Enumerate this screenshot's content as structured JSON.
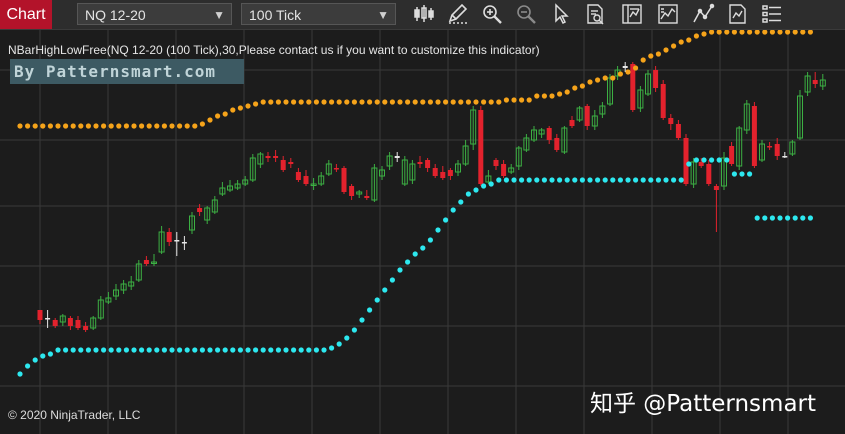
{
  "toolbar": {
    "chart_tab": "Chart",
    "instrument": "NQ 12-20",
    "period": "100 Tick",
    "icons": [
      "bar-type-icon",
      "draw-pencil-icon",
      "zoom-in-icon",
      "zoom-out-icon",
      "cursor-icon",
      "data-box-icon",
      "indicators-icon",
      "strategies-icon",
      "line-drawing-icon",
      "chart-style-icon",
      "properties-icon"
    ]
  },
  "chart": {
    "indicator_label": "NBarHighLowFree(NQ 12-20 (100 Tick),30,Please contact us if you want to customize this indicator)",
    "brand_label": "By Patternsmart.com",
    "copyright": "© 2020 NinjaTrader, LLC",
    "watermark": "知乎 @Patternsmart",
    "colors": {
      "background": "#1c1c1c",
      "grid": "#3a3a3a",
      "up_candle": "#3cb043",
      "down_candle": "#e3222d",
      "neutral_candle": "#e6e6e6",
      "high_dots": "#f5a31a",
      "low_dots": "#2de8ef"
    }
  },
  "chart_data": {
    "type": "candlestick",
    "candles": [
      [
        320,
        310,
        316,
        324,
        "d"
      ],
      [
        318,
        318,
        310,
        328,
        "n"
      ],
      [
        326,
        320,
        318,
        328,
        "d"
      ],
      [
        322,
        316,
        314,
        326,
        "u"
      ],
      [
        318,
        326,
        316,
        330,
        "d"
      ],
      [
        320,
        328,
        316,
        330,
        "d"
      ],
      [
        330,
        326,
        322,
        332,
        "d"
      ],
      [
        328,
        318,
        316,
        330,
        "u"
      ],
      [
        318,
        300,
        296,
        320,
        "u"
      ],
      [
        302,
        298,
        292,
        304,
        "u"
      ],
      [
        296,
        290,
        284,
        300,
        "u"
      ],
      [
        290,
        284,
        280,
        294,
        "u"
      ],
      [
        286,
        282,
        276,
        290,
        "u"
      ],
      [
        280,
        264,
        260,
        282,
        "u"
      ],
      [
        264,
        260,
        256,
        266,
        "d"
      ],
      [
        262,
        262,
        254,
        266,
        "u"
      ],
      [
        252,
        232,
        226,
        254,
        "u"
      ],
      [
        232,
        242,
        228,
        246,
        "d"
      ],
      [
        240,
        240,
        232,
        256,
        "n"
      ],
      [
        242,
        242,
        236,
        250,
        "n"
      ],
      [
        230,
        216,
        212,
        234,
        "u"
      ],
      [
        212,
        208,
        204,
        216,
        "d"
      ],
      [
        220,
        208,
        206,
        224,
        "u"
      ],
      [
        212,
        200,
        196,
        214,
        "u"
      ],
      [
        194,
        188,
        182,
        196,
        "u"
      ],
      [
        190,
        186,
        180,
        192,
        "u"
      ],
      [
        188,
        184,
        180,
        190,
        "u"
      ],
      [
        184,
        180,
        176,
        186,
        "u"
      ],
      [
        180,
        158,
        154,
        182,
        "u"
      ],
      [
        164,
        154,
        152,
        168,
        "u"
      ],
      [
        158,
        156,
        152,
        162,
        "d"
      ],
      [
        156,
        158,
        150,
        162,
        "d"
      ],
      [
        160,
        170,
        156,
        172,
        "d"
      ],
      [
        164,
        162,
        158,
        168,
        "d"
      ],
      [
        172,
        180,
        168,
        182,
        "d"
      ],
      [
        176,
        184,
        170,
        186,
        "d"
      ],
      [
        184,
        184,
        178,
        190,
        "u"
      ],
      [
        184,
        176,
        172,
        186,
        "u"
      ],
      [
        174,
        164,
        160,
        176,
        "u"
      ],
      [
        168,
        168,
        164,
        172,
        "d"
      ],
      [
        168,
        192,
        166,
        194,
        "d"
      ],
      [
        186,
        196,
        184,
        200,
        "d"
      ],
      [
        194,
        192,
        190,
        198,
        "u"
      ],
      [
        196,
        198,
        190,
        200,
        "d"
      ],
      [
        200,
        168,
        164,
        202,
        "u"
      ],
      [
        170,
        176,
        166,
        180,
        "u"
      ],
      [
        166,
        156,
        152,
        170,
        "u"
      ],
      [
        158,
        156,
        152,
        162,
        "n"
      ],
      [
        160,
        184,
        156,
        186,
        "u"
      ],
      [
        180,
        164,
        160,
        184,
        "u"
      ],
      [
        164,
        162,
        156,
        168,
        "d"
      ],
      [
        160,
        168,
        158,
        172,
        "d"
      ],
      [
        168,
        176,
        164,
        178,
        "d"
      ],
      [
        172,
        178,
        166,
        180,
        "d"
      ],
      [
        176,
        170,
        168,
        180,
        "d"
      ],
      [
        172,
        164,
        160,
        176,
        "u"
      ],
      [
        164,
        146,
        140,
        166,
        "u"
      ],
      [
        144,
        110,
        106,
        150,
        "u"
      ],
      [
        110,
        184,
        106,
        186,
        "d"
      ],
      [
        176,
        182,
        170,
        184,
        "u"
      ],
      [
        166,
        160,
        158,
        170,
        "d"
      ],
      [
        164,
        176,
        160,
        178,
        "d"
      ],
      [
        172,
        168,
        164,
        174,
        "u"
      ],
      [
        166,
        148,
        146,
        170,
        "u"
      ],
      [
        150,
        138,
        134,
        152,
        "u"
      ],
      [
        140,
        130,
        126,
        142,
        "u"
      ],
      [
        130,
        134,
        128,
        138,
        "u"
      ],
      [
        128,
        140,
        126,
        144,
        "d"
      ],
      [
        138,
        150,
        134,
        152,
        "d"
      ],
      [
        152,
        128,
        126,
        154,
        "u"
      ],
      [
        126,
        120,
        116,
        128,
        "d"
      ],
      [
        120,
        108,
        106,
        122,
        "u"
      ],
      [
        106,
        126,
        104,
        130,
        "d"
      ],
      [
        126,
        116,
        110,
        130,
        "u"
      ],
      [
        114,
        106,
        102,
        118,
        "u"
      ],
      [
        104,
        78,
        74,
        106,
        "u"
      ],
      [
        76,
        70,
        66,
        80,
        "u"
      ],
      [
        68,
        66,
        62,
        72,
        "n"
      ],
      [
        64,
        110,
        62,
        112,
        "d"
      ],
      [
        108,
        90,
        86,
        112,
        "u"
      ],
      [
        94,
        74,
        70,
        96,
        "u"
      ],
      [
        70,
        88,
        66,
        92,
        "d"
      ],
      [
        84,
        118,
        80,
        120,
        "d"
      ],
      [
        118,
        124,
        114,
        130,
        "d"
      ],
      [
        124,
        138,
        120,
        140,
        "d"
      ],
      [
        138,
        184,
        134,
        186,
        "d"
      ],
      [
        184,
        162,
        158,
        188,
        "u"
      ],
      [
        162,
        166,
        158,
        168,
        "d"
      ],
      [
        164,
        184,
        160,
        186,
        "d"
      ],
      [
        186,
        190,
        184,
        232,
        "d"
      ],
      [
        186,
        158,
        152,
        190,
        "u"
      ],
      [
        146,
        164,
        142,
        166,
        "d"
      ],
      [
        166,
        128,
        126,
        170,
        "u"
      ],
      [
        130,
        104,
        100,
        134,
        "u"
      ],
      [
        106,
        166,
        102,
        168,
        "d"
      ],
      [
        160,
        144,
        140,
        162,
        "u"
      ],
      [
        146,
        146,
        142,
        150,
        "d"
      ],
      [
        144,
        156,
        138,
        160,
        "d"
      ],
      [
        156,
        156,
        152,
        158,
        "n"
      ],
      [
        154,
        142,
        140,
        156,
        "u"
      ],
      [
        138,
        96,
        90,
        140,
        "u"
      ],
      [
        92,
        76,
        72,
        96,
        "u"
      ],
      [
        80,
        84,
        72,
        88,
        "d"
      ],
      [
        86,
        80,
        74,
        90,
        "u"
      ]
    ],
    "high_line_y": [
      176,
      176,
      176,
      176,
      176,
      176,
      176,
      176,
      176,
      176,
      176,
      176,
      176,
      176,
      176,
      176,
      176,
      176,
      176,
      176,
      176,
      176,
      176,
      176,
      174,
      170,
      166,
      164,
      160,
      158,
      156,
      154,
      152,
      152,
      152,
      152,
      152,
      152,
      152,
      152,
      152,
      152,
      152,
      152,
      152,
      152,
      152,
      152,
      152,
      152,
      152,
      152,
      152,
      152,
      152,
      152,
      152,
      152,
      152,
      152,
      152,
      152,
      152,
      152,
      150,
      150,
      150,
      150,
      146,
      146,
      146,
      144,
      142,
      138,
      136,
      132,
      130,
      128,
      128,
      124,
      122,
      118,
      110,
      106,
      104,
      100,
      96,
      92,
      90,
      86,
      84,
      82,
      82,
      82,
      82,
      82,
      82,
      82,
      82,
      82,
      82,
      82,
      82,
      82,
      82,
      82
    ],
    "low_line_y": [
      370,
      362,
      356,
      352,
      350,
      346,
      346,
      346,
      346,
      346,
      346,
      346,
      346,
      346,
      346,
      346,
      346,
      346,
      346,
      346,
      346,
      346,
      346,
      346,
      346,
      346,
      346,
      346,
      346,
      346,
      346,
      346,
      346,
      346,
      346,
      346,
      346,
      346,
      346,
      346,
      346,
      344,
      340,
      334,
      326,
      316,
      306,
      296,
      286,
      276,
      266,
      258,
      250,
      244,
      236,
      226,
      216,
      206,
      198,
      190,
      186,
      182,
      180,
      176,
      176,
      176,
      176,
      176,
      176,
      176,
      176,
      176,
      176,
      176,
      176,
      176,
      176,
      176,
      176,
      176,
      176,
      176,
      176,
      176,
      176,
      176,
      176,
      176,
      160,
      156,
      156,
      156,
      156,
      156,
      170,
      170,
      170,
      214,
      214,
      214,
      214,
      214,
      214,
      214,
      214,
      214
    ]
  }
}
